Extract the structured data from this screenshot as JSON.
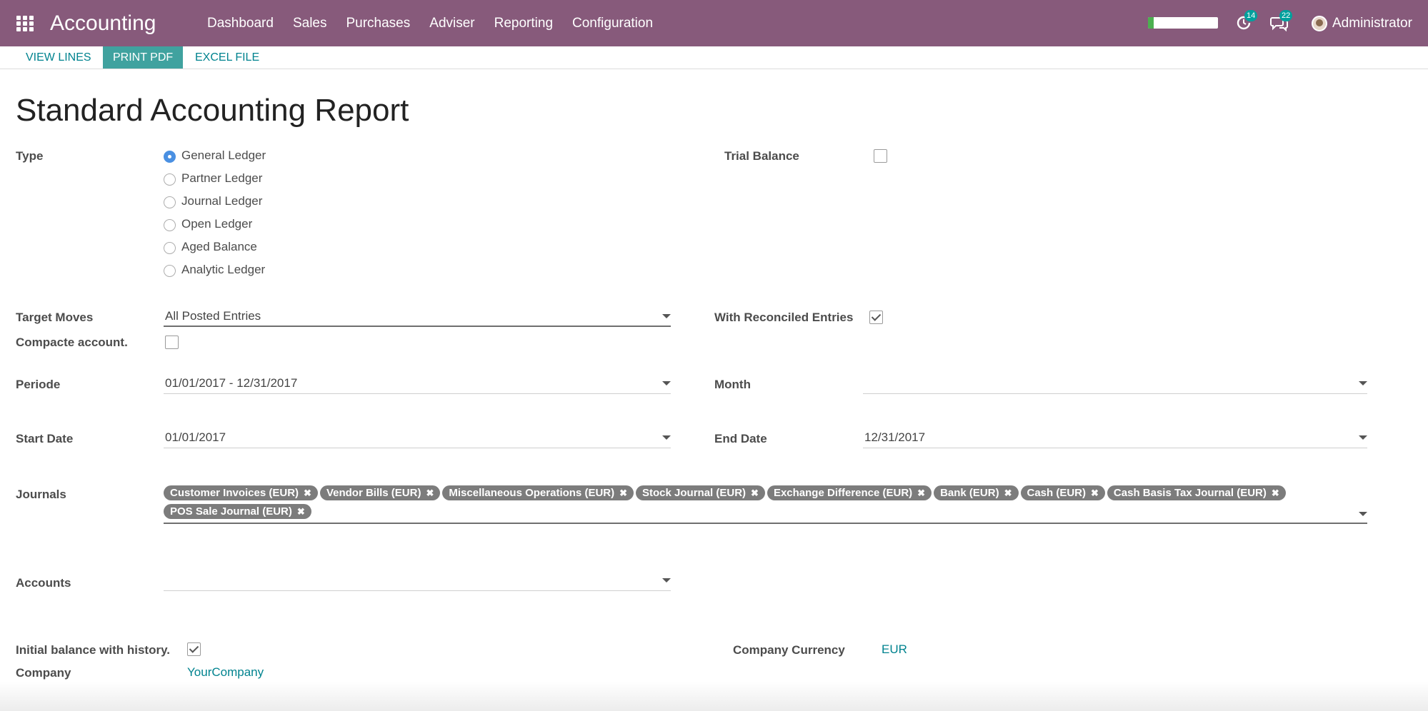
{
  "navbar": {
    "app_title": "Accounting",
    "menu": [
      "Dashboard",
      "Sales",
      "Purchases",
      "Adviser",
      "Reporting",
      "Configuration"
    ],
    "progress_fraction": 0.08,
    "activity_count": "14",
    "messages_count": "22",
    "user_name": "Administrator",
    "bg_color": "#875a7b"
  },
  "actions": {
    "view_lines": "VIEW LINES",
    "print_pdf": "PRINT PDF",
    "excel_file": "EXCEL FILE"
  },
  "page": {
    "title": "Standard Accounting Report"
  },
  "form": {
    "type_label": "Type",
    "type_options": [
      "General Ledger",
      "Partner Ledger",
      "Journal Ledger",
      "Open Ledger",
      "Aged Balance",
      "Analytic Ledger"
    ],
    "type_selected": "General Ledger",
    "trial_balance_label": "Trial Balance",
    "trial_balance_checked": false,
    "target_moves_label": "Target Moves",
    "target_moves_value": "All Posted Entries",
    "with_reconciled_label": "With Reconciled Entries",
    "with_reconciled_checked": true,
    "compact_label": "Compacte account.",
    "compact_checked": false,
    "periode_label": "Periode",
    "periode_value": "01/01/2017 - 12/31/2017",
    "month_label": "Month",
    "month_value": "",
    "start_date_label": "Start Date",
    "start_date_value": "01/01/2017",
    "end_date_label": "End Date",
    "end_date_value": "12/31/2017",
    "journals_label": "Journals",
    "journals": [
      "Customer Invoices (EUR)",
      "Vendor Bills (EUR)",
      "Miscellaneous Operations (EUR)",
      "Stock Journal (EUR)",
      "Exchange Difference (EUR)",
      "Bank (EUR)",
      "Cash (EUR)",
      "Cash Basis Tax Journal (EUR)",
      "POS Sale Journal (EUR)"
    ],
    "accounts_label": "Accounts",
    "accounts_value": "",
    "initial_balance_label": "Initial balance with history.",
    "initial_balance_checked": true,
    "company_currency_label": "Company Currency",
    "company_currency_value": "EUR",
    "company_label": "Company",
    "company_value": "YourCompany"
  }
}
